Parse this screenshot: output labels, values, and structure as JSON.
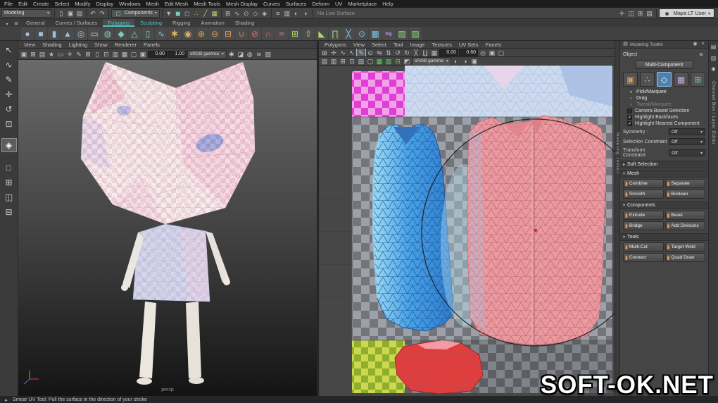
{
  "colors": {
    "accent_teal": "#53c1c1",
    "highlight_blue": "#4f81ab",
    "icon_orange": "#e8a050"
  },
  "menubar": {
    "items": [
      "File",
      "Edit",
      "Create",
      "Select",
      "Modify",
      "Display",
      "Windows",
      "Mesh",
      "Edit Mesh",
      "Mesh Tools",
      "Mesh Display",
      "Curves",
      "Surfaces",
      "Deform",
      "UV",
      "Marketplace",
      "Help"
    ]
  },
  "statusline": {
    "menuset": "Modeling",
    "file_icons": [
      {
        "name": "new-scene-icon",
        "glyph": "▯"
      },
      {
        "name": "open-scene-icon",
        "glyph": "▣"
      },
      {
        "name": "save-scene-icon",
        "glyph": "▤"
      }
    ],
    "undo_icons": [
      {
        "name": "undo-icon",
        "glyph": "↶"
      },
      {
        "name": "redo-icon",
        "glyph": "↷"
      }
    ],
    "selection_mode_label": "Components",
    "mask_icons": [
      {
        "name": "select-hierarchy-icon",
        "glyph": "▼",
        "color": "#b8b8b8"
      },
      {
        "name": "select-object-icon",
        "glyph": "◼",
        "color": "#7ec8c0"
      },
      {
        "name": "select-component-icon",
        "glyph": "◻",
        "color": "#7ec8c0"
      },
      {
        "name": "mask-points-icon",
        "glyph": "∴",
        "color": "#c8c870"
      },
      {
        "name": "mask-lines-icon",
        "glyph": "╱",
        "color": "#c8c870"
      },
      {
        "name": "mask-faces-icon",
        "glyph": "▦",
        "color": "#c8c870"
      }
    ],
    "snap_icons": [
      {
        "name": "snap-grid-icon",
        "glyph": "⊞"
      },
      {
        "name": "snap-curve-icon",
        "glyph": "∿"
      },
      {
        "name": "snap-point-icon",
        "glyph": "⊙"
      },
      {
        "name": "snap-plane-icon",
        "glyph": "◇"
      },
      {
        "name": "make-live-icon",
        "glyph": "◈"
      }
    ],
    "history_icons": [
      {
        "name": "construction-history-icon",
        "glyph": "≡"
      },
      {
        "name": "open-render-view-icon",
        "glyph": "▥"
      },
      {
        "name": "render-frame-icon",
        "glyph": "◐"
      },
      {
        "name": "ipr-render-icon",
        "glyph": "◑"
      }
    ],
    "live_surface": "No Live Surface",
    "right_icons": [
      {
        "name": "show-manipulator-icon",
        "glyph": "✛"
      },
      {
        "name": "workspace-icon",
        "glyph": "◫"
      },
      {
        "name": "panel-layout-icon",
        "glyph": "⊞"
      },
      {
        "name": "outliner-toggle-icon",
        "glyph": "▤"
      }
    ],
    "user_label": "Maya LT User"
  },
  "shelf": {
    "tabs": [
      {
        "label": "General"
      },
      {
        "label": "Curves / Surfaces"
      },
      {
        "label": "Polygons",
        "active": true
      },
      {
        "label": "Sculpting",
        "accent": true
      },
      {
        "label": "Rigging"
      },
      {
        "label": "Animation"
      },
      {
        "label": "Shading"
      }
    ],
    "icons": [
      {
        "name": "poly-sphere-icon",
        "glyph": "●",
        "color": "#9fc0dc"
      },
      {
        "name": "poly-cube-icon",
        "glyph": "■",
        "color": "#9fc0dc"
      },
      {
        "name": "poly-cylinder-icon",
        "glyph": "▮",
        "color": "#9fc0dc"
      },
      {
        "name": "poly-cone-icon",
        "glyph": "▲",
        "color": "#9fc0dc"
      },
      {
        "name": "poly-torus-icon",
        "glyph": "◎",
        "color": "#9fc0dc"
      },
      {
        "name": "poly-plane-icon",
        "glyph": "▭",
        "color": "#9fc0dc"
      },
      {
        "name": "poly-disc-icon",
        "glyph": "◍",
        "color": "#7ec8c0"
      },
      {
        "name": "poly-platonic-icon",
        "glyph": "◆",
        "color": "#7ec8c0"
      },
      {
        "name": "poly-pyramid-icon",
        "glyph": "△",
        "color": "#7ec8c0"
      },
      {
        "name": "poly-pipe-icon",
        "glyph": "▯",
        "color": "#7ec8c0"
      },
      {
        "name": "poly-helix-icon",
        "glyph": "∿",
        "color": "#7ec8c0"
      },
      {
        "name": "poly-gear-icon",
        "glyph": "✱",
        "color": "#d8b868"
      },
      {
        "name": "poly-soccer-icon",
        "glyph": "◉",
        "color": "#d8b868"
      },
      {
        "name": "combine-icon",
        "glyph": "⊕",
        "color": "#e8a050"
      },
      {
        "name": "separate-icon",
        "glyph": "⊖",
        "color": "#e8a050"
      },
      {
        "name": "extract-icon",
        "glyph": "⊟",
        "color": "#e8a050"
      },
      {
        "name": "boolean-union-icon",
        "glyph": "∪",
        "color": "#e07070"
      },
      {
        "name": "boolean-difference-icon",
        "glyph": "⊘",
        "color": "#e07070"
      },
      {
        "name": "boolean-intersection-icon",
        "glyph": "∩",
        "color": "#e07070"
      },
      {
        "name": "smooth-icon",
        "glyph": "≈",
        "color": "#e88cb0"
      },
      {
        "name": "add-divisions-icon",
        "glyph": "⊞",
        "color": "#a8d868"
      },
      {
        "name": "extrude-icon",
        "glyph": "⇧",
        "color": "#a8d868"
      },
      {
        "name": "bevel-icon",
        "glyph": "◣",
        "color": "#a8d868"
      },
      {
        "name": "bridge-icon",
        "glyph": "∏",
        "color": "#a8d868"
      },
      {
        "name": "multi-cut-icon",
        "glyph": "╳",
        "color": "#78c8e8"
      },
      {
        "name": "target-weld-icon",
        "glyph": "⊙",
        "color": "#78c8e8"
      },
      {
        "name": "quad-draw-icon",
        "glyph": "▦",
        "color": "#78c8e8"
      },
      {
        "name": "mirror-icon",
        "glyph": "⇋",
        "color": "#b898e8"
      },
      {
        "name": "uv-editor-icon",
        "glyph": "▨",
        "color": "#88d878"
      },
      {
        "name": "uv-snapshot-icon",
        "glyph": "▧",
        "color": "#88d878"
      }
    ]
  },
  "toolbox": {
    "tools": [
      {
        "name": "select-tool-icon",
        "glyph": "↖"
      },
      {
        "name": "lasso-tool-icon",
        "glyph": "∿"
      },
      {
        "name": "paint-select-tool-icon",
        "glyph": "✎"
      },
      {
        "name": "move-tool-icon",
        "glyph": "✛"
      },
      {
        "name": "rotate-tool-icon",
        "glyph": "↺"
      },
      {
        "name": "scale-tool-icon",
        "glyph": "⊡"
      }
    ],
    "current_tool": {
      "name": "smear-uv-current-tool",
      "glyph": "◈"
    },
    "layout_buttons": [
      {
        "name": "single-pane-layout-icon",
        "glyph": "□"
      },
      {
        "name": "four-pane-layout-icon",
        "glyph": "⊞"
      },
      {
        "name": "two-pane-layout-icon",
        "glyph": "◫"
      },
      {
        "name": "persp-outliner-layout-icon",
        "glyph": "⊟"
      }
    ]
  },
  "viewport_left": {
    "menus": [
      "View",
      "Shading",
      "Lighting",
      "Show",
      "Renderer",
      "Panels"
    ],
    "toolbar_icons_a": [
      {
        "name": "select-camera-icon",
        "glyph": "▣"
      },
      {
        "name": "lock-camera-icon",
        "glyph": "⊠"
      },
      {
        "name": "camera-attributes-icon",
        "glyph": "▤"
      },
      {
        "name": "bookmarks-icon",
        "glyph": "★"
      },
      {
        "name": "image-plane-icon",
        "glyph": "▭"
      },
      {
        "name": "pan-zoom-icon",
        "glyph": "✛"
      },
      {
        "name": "grease-pencil-icon",
        "glyph": "✎"
      },
      {
        "name": "grid-toggle-icon",
        "glyph": "⊞"
      },
      {
        "name": "film-gate-icon",
        "glyph": "▯"
      },
      {
        "name": "resolution-gate-icon",
        "glyph": "⊡"
      },
      {
        "name": "gate-mask-icon",
        "glyph": "▥"
      },
      {
        "name": "field-chart-icon",
        "glyph": "▦"
      },
      {
        "name": "safe-action-icon",
        "glyph": "▢"
      },
      {
        "name": "safe-title-icon",
        "glyph": "▣"
      }
    ],
    "exposure": "0.00",
    "gamma": "1.00",
    "gamma_mode": "sRGB gamma",
    "toolbar_icons_b": [
      {
        "name": "lighting-icon",
        "glyph": "✱"
      },
      {
        "name": "shadows-icon",
        "glyph": "◪"
      },
      {
        "name": "ambient-occlusion-icon",
        "glyph": "◍"
      },
      {
        "name": "anti-aliasing-icon",
        "glyph": "≋"
      },
      {
        "name": "xray-icon",
        "glyph": "▨"
      }
    ],
    "camera_label": "persp"
  },
  "uv_editor": {
    "menus": [
      "Polygons",
      "View",
      "Select",
      "Tool",
      "Image",
      "Textures",
      "UV Sets",
      "Panels"
    ],
    "toolbar1_icons": [
      {
        "name": "uv-lattice-tool-icon",
        "glyph": "⊞"
      },
      {
        "name": "move-uv-shell-icon",
        "glyph": "✛"
      },
      {
        "name": "select-shortest-path-icon",
        "glyph": "∿"
      },
      {
        "name": "tweak-uv-icon",
        "glyph": "↖"
      },
      {
        "name": "smear-uv-tool-icon",
        "glyph": "✎",
        "cls": "active-tool"
      },
      {
        "name": "pin-uv-icon",
        "glyph": "⊙"
      },
      {
        "name": "flip-u-icon",
        "glyph": "⇋"
      },
      {
        "name": "flip-v-icon",
        "glyph": "⇅"
      },
      {
        "name": "rotate-uv-ccw-icon",
        "glyph": "↺"
      },
      {
        "name": "rotate-uv-cw-icon",
        "glyph": "↻"
      },
      {
        "name": "cut-uv-icon",
        "glyph": "╳"
      },
      {
        "name": "sew-uv-icon",
        "glyph": "∐"
      },
      {
        "name": "layout-uv-icon",
        "glyph": "▦"
      }
    ],
    "field_u": "0.00",
    "field_v": "0.60",
    "toolbar1_icons_b": [
      {
        "name": "snap-uv-icon",
        "glyph": "◎"
      },
      {
        "name": "normalize-uv-icon",
        "glyph": "▣"
      },
      {
        "name": "unitize-uv-icon",
        "glyph": "▢"
      }
    ],
    "toolbar2_icons": [
      {
        "name": "display-image-icon",
        "glyph": "▤"
      },
      {
        "name": "dim-image-icon",
        "glyph": "▥"
      },
      {
        "name": "view-grid-icon",
        "glyph": "⊞"
      },
      {
        "name": "pixel-snap-icon",
        "glyph": "⊡"
      },
      {
        "name": "shaded-uv-icon",
        "glyph": "▧"
      },
      {
        "name": "texture-borders-icon",
        "glyph": "▢"
      },
      {
        "name": "checker-map-icon",
        "glyph": "▦",
        "color": "#58d858"
      },
      {
        "name": "distortion-icon",
        "glyph": "▨",
        "color": "#58d858"
      },
      {
        "name": "uv-tile-icon",
        "glyph": "⊟",
        "color": "#58d858"
      },
      {
        "name": "isolate-select-icon",
        "glyph": "◩"
      }
    ],
    "gamma_mode": "sRGB gamma",
    "toolbar2_icons_b": [
      {
        "name": "exposure-icon",
        "glyph": "◐"
      },
      {
        "name": "gamma-icon",
        "glyph": "◑"
      },
      {
        "name": "baked-texture-icon",
        "glyph": "▣"
      }
    ]
  },
  "toolkit": {
    "vertical_tab": "Modeling Toolkit",
    "header_title": "Modeling Toolkit",
    "object_label": "Object",
    "multi_component_label": "Multi-Component",
    "component_modes": [
      {
        "name": "multi-component-mode-icon",
        "glyph": "▣",
        "color": "#e09858"
      },
      {
        "name": "vertex-mode-icon",
        "glyph": "∴",
        "color": "#d8d8d8"
      },
      {
        "name": "edge-mode-icon",
        "glyph": "◇",
        "color": "#ffffff",
        "active": true
      },
      {
        "name": "face-mode-icon",
        "glyph": "▦",
        "color": "#c8a8e0"
      },
      {
        "name": "uv-mode-icon",
        "glyph": "⊞",
        "color": "#7ec8c0"
      }
    ],
    "select_options": [
      {
        "label": "Pick/Marquee",
        "state": "selected"
      },
      {
        "label": "Drag",
        "state": "normal"
      },
      {
        "label": "Tweak/Marquee",
        "state": "disabled"
      }
    ],
    "checkboxes": [
      {
        "label": "Camera Based Selection",
        "checked": false
      },
      {
        "label": "Highlight Backfaces",
        "checked": true
      },
      {
        "label": "Highlight Nearest Component",
        "checked": true
      }
    ],
    "dropdown_rows": [
      {
        "label": "Symmetry :",
        "value": "Off"
      },
      {
        "label": "Selection Constraint",
        "value": "Off"
      },
      {
        "label": "Transform Constraint",
        "value": "Off"
      }
    ],
    "soft_selection_label": "Soft Selection",
    "sections": [
      {
        "title": "Mesh",
        "buttons": [
          "Combine",
          "Separate",
          "Smooth",
          "Boolean"
        ]
      },
      {
        "title": "Components",
        "buttons": [
          "Extrude",
          "Bevel",
          "Bridge",
          "Add Divisions"
        ]
      },
      {
        "title": "Tools",
        "buttons": [
          "Multi-Cut",
          "Target Weld",
          "Connect",
          "Quad Draw"
        ]
      }
    ]
  },
  "right_strip": {
    "icons": [
      {
        "name": "channel-box-icon",
        "glyph": "▤"
      },
      {
        "name": "attribute-editor-icon",
        "glyph": "▥"
      },
      {
        "name": "tool-settings-icon",
        "glyph": "✱"
      }
    ],
    "tab_label": "Channel Box / Layer Editor"
  },
  "helpbar": {
    "text": "Smear UV Tool: Pull the surface in the direction of your stroke"
  },
  "watermark": "SOFT-OK.NET"
}
